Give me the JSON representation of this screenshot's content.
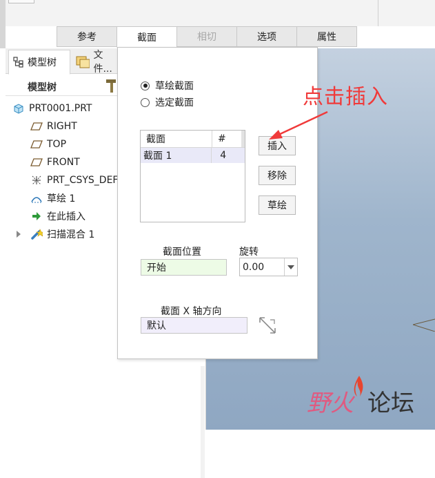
{
  "ribbon_tabs": [
    {
      "label": "参考",
      "state": "normal"
    },
    {
      "label": "截面",
      "state": "active"
    },
    {
      "label": "相切",
      "state": "disabled"
    },
    {
      "label": "选项",
      "state": "normal"
    },
    {
      "label": "属性",
      "state": "normal"
    }
  ],
  "left_pane": {
    "tabs": {
      "model_tree": "模型树",
      "files": "文件..."
    },
    "tree_header": "模型树",
    "nodes": [
      {
        "label": "PRT0001.PRT",
        "icon": "part-icon"
      },
      {
        "label": "RIGHT",
        "icon": "datum-plane-icon"
      },
      {
        "label": "TOP",
        "icon": "datum-plane-icon"
      },
      {
        "label": "FRONT",
        "icon": "datum-plane-icon"
      },
      {
        "label": "PRT_CSYS_DEF",
        "icon": "coordinate-system-icon"
      },
      {
        "label": "草绘 1",
        "icon": "sketch-icon"
      },
      {
        "label": "在此插入",
        "icon": "insert-here-icon"
      },
      {
        "label": "扫描混合 1",
        "icon": "swept-blend-icon"
      }
    ]
  },
  "sections_panel": {
    "radio_sketched": "草绘截面",
    "radio_selected": "选定截面",
    "selected_radio": "草绘截面",
    "table": {
      "headers": [
        "截面",
        "#"
      ],
      "rows": [
        {
          "name": "截面 1",
          "count": "4"
        }
      ]
    },
    "buttons": {
      "insert": "插入",
      "remove": "移除",
      "sketch": "草绘"
    },
    "section_location_label": "截面位置",
    "section_location_value": "开始",
    "rotation_label": "旋转",
    "rotation_value": "0.00",
    "x_axis_label": "截面 X 轴方向",
    "x_axis_value": "默认"
  },
  "annotation": {
    "text": "点击插入",
    "color": "#f03a3a"
  },
  "watermark": {
    "text_red": "野火",
    "text_dark": "论坛"
  }
}
